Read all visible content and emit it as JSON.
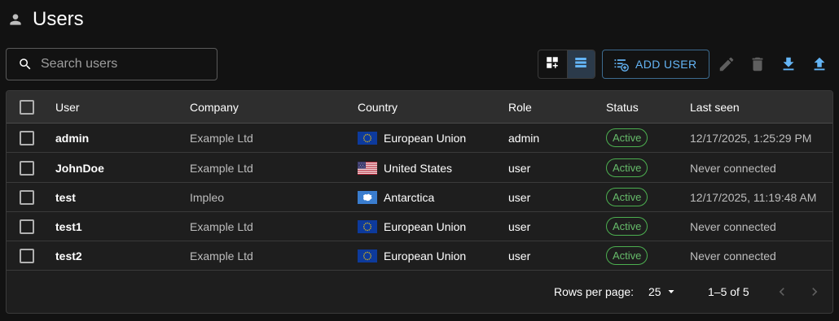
{
  "header": {
    "title": "Users"
  },
  "search": {
    "placeholder": "Search users",
    "value": ""
  },
  "toolbar": {
    "add_user_label": "ADD USER",
    "view_modes": [
      "grid-view",
      "list-view"
    ],
    "active_view": "list-view",
    "actions": [
      "edit-icon",
      "delete-icon",
      "download-icon",
      "upload-icon"
    ]
  },
  "table": {
    "columns": [
      "User",
      "Company",
      "Country",
      "Role",
      "Status",
      "Last seen"
    ],
    "rows": [
      {
        "user": "admin",
        "company": "Example Ltd",
        "country": "European Union",
        "flag": "eu",
        "role": "admin",
        "status": "Active",
        "last_seen": "12/17/2025, 1:25:29 PM"
      },
      {
        "user": "JohnDoe",
        "company": "Example Ltd",
        "country": "United States",
        "flag": "us",
        "role": "user",
        "status": "Active",
        "last_seen": "Never connected"
      },
      {
        "user": "test",
        "company": "Impleo",
        "country": "Antarctica",
        "flag": "aq",
        "role": "user",
        "status": "Active",
        "last_seen": "12/17/2025, 11:19:48 AM"
      },
      {
        "user": "test1",
        "company": "Example Ltd",
        "country": "European Union",
        "flag": "eu",
        "role": "user",
        "status": "Active",
        "last_seen": "Never connected"
      },
      {
        "user": "test2",
        "company": "Example Ltd",
        "country": "European Union",
        "flag": "eu",
        "role": "user",
        "status": "Active",
        "last_seen": "Never connected"
      }
    ]
  },
  "pagination": {
    "rows_per_page_label": "Rows per page:",
    "rows_per_page_value": "25",
    "range_label": "1–5 of 5"
  },
  "colors": {
    "background": "#121212",
    "surface": "#1e1e1e",
    "accent": "#64b5f6",
    "status_active": "#66bb6a"
  }
}
